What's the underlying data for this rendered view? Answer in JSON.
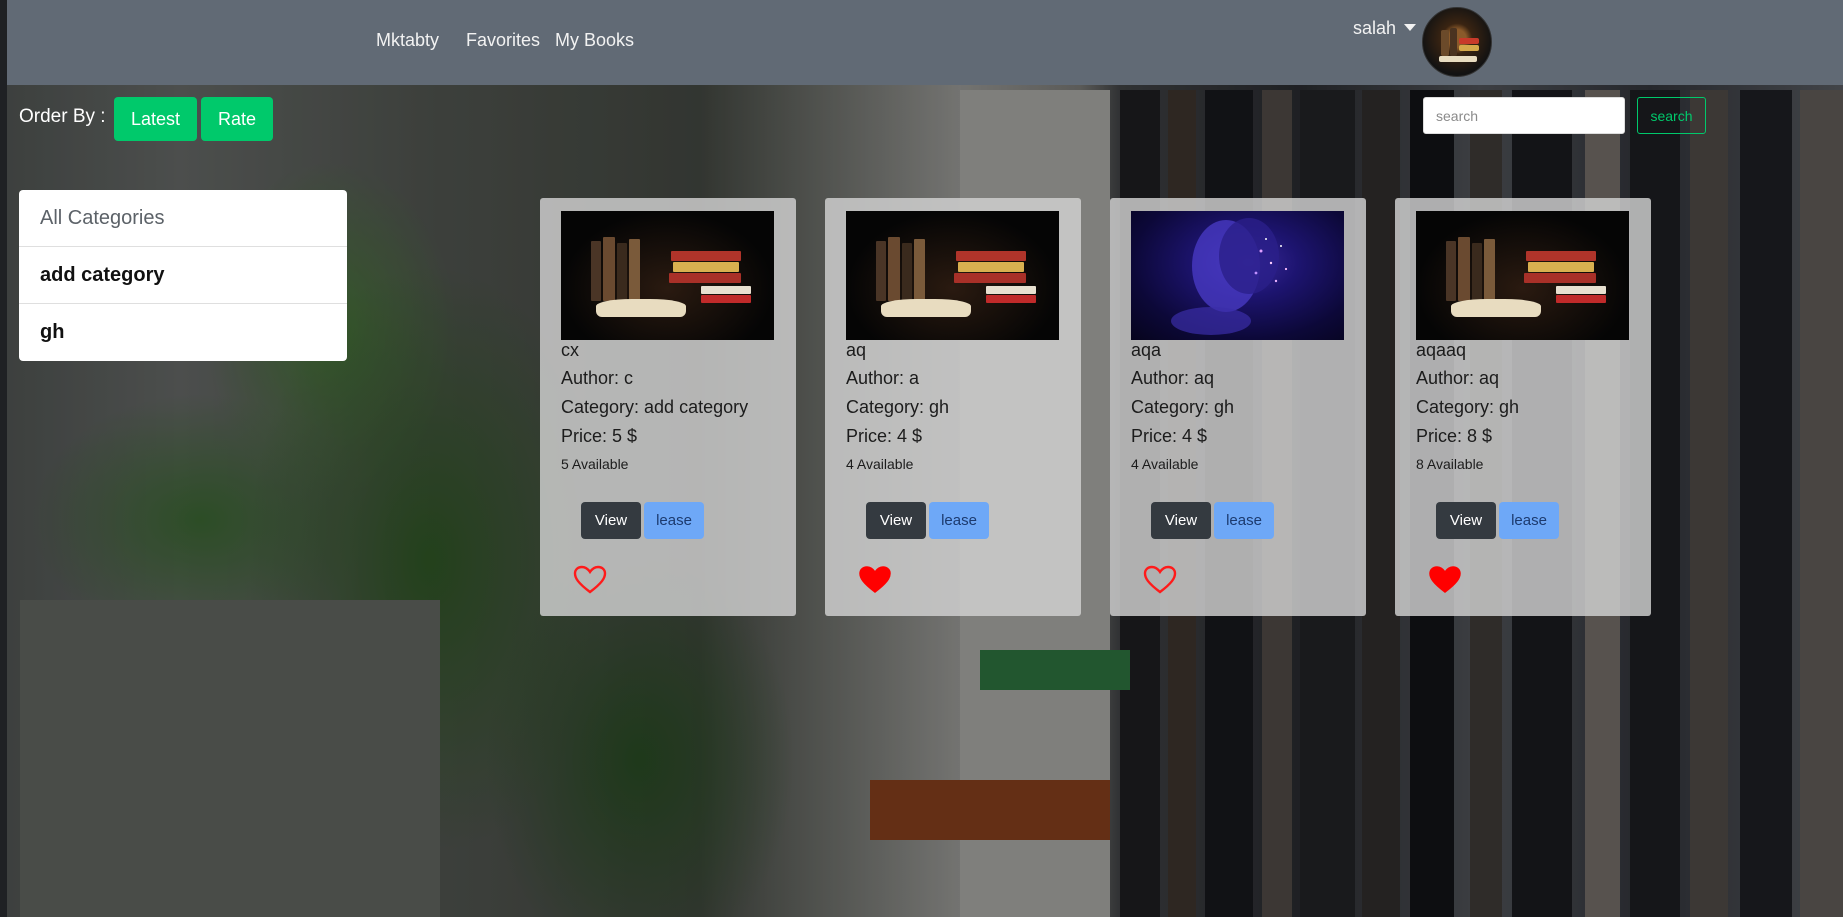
{
  "navbar": {
    "brand": "Mktabty",
    "links": [
      "Favorites",
      "My Books"
    ],
    "user_name": "salah"
  },
  "order": {
    "label": "Order By :",
    "buttons": [
      "Latest",
      "Rate"
    ]
  },
  "search": {
    "placeholder": "search",
    "button_label": "search"
  },
  "categories": {
    "header": "All Categories",
    "items": [
      "add category",
      "gh"
    ]
  },
  "books": [
    {
      "title": "cx",
      "author": "Author: c",
      "category": "Category: add category",
      "price": "Price: 5 $",
      "available": "5 Available",
      "favorite": false,
      "cover": "books-image"
    },
    {
      "title": "aq",
      "author": "Author: a",
      "category": "Category: gh",
      "price": "Price: 4 $",
      "available": "4 Available",
      "favorite": true,
      "cover": "books-image"
    },
    {
      "title": "aqa",
      "author": "Author: aq",
      "category": "Category: gh",
      "price": "Price: 4 $",
      "available": "4 Available",
      "favorite": false,
      "cover": "blue-face-image"
    },
    {
      "title": "aqaaq",
      "author": "Author: aq",
      "category": "Category: gh",
      "price": "Price: 8 $",
      "available": "8 Available",
      "favorite": true,
      "cover": "books-image"
    }
  ],
  "card_buttons": {
    "view": "View",
    "lease": "lease"
  },
  "colors": {
    "navbar": "#616a75",
    "accent_green": "#00c96b",
    "view_button": "#343a40",
    "lease_button": "#6ea8f7",
    "heart": "#ff0000"
  }
}
